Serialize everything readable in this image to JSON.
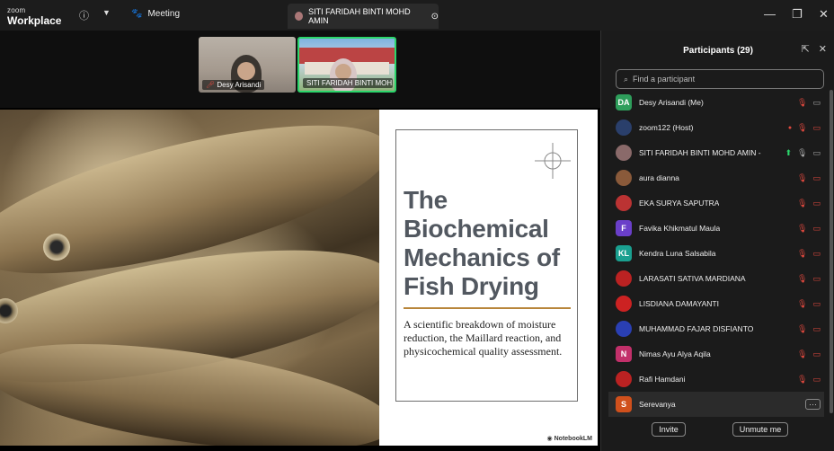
{
  "app": {
    "brand_small": "zoom",
    "brand_large": "Workplace"
  },
  "titlebar": {
    "meeting_label": "Meeting",
    "active_tab_label": "SITI FARIDAH BINTI MOHD AMIN"
  },
  "videos": [
    {
      "name": "Desy Arisandi"
    },
    {
      "name": "SITI FARIDAH BINTI MOH..."
    }
  ],
  "slide": {
    "title": "The Biochemical Mechanics of Fish Drying",
    "subtitle": "A scientific breakdown of moisture reduction, the Maillard reaction, and physicochemical quality assessment.",
    "watermark": "NotebookLM"
  },
  "panel": {
    "title": "Participants (29)",
    "search_placeholder": "Find a participant",
    "participants": [
      {
        "initials": "DA",
        "name": "Desy Arisandi (Me)",
        "color": "#2e9e5b",
        "photo": false
      },
      {
        "initials": "",
        "name": "zoom122 (Host)",
        "color": "#2a3f6b",
        "photo": true
      },
      {
        "initials": "",
        "name": "SITI FARIDAH BINTI MOHD AMIN -",
        "color": "#8a6a6a",
        "photo": true
      },
      {
        "initials": "",
        "name": "aura dianna",
        "color": "#8a5a3a",
        "photo": true
      },
      {
        "initials": "",
        "name": "EKA SURYA SAPUTRA",
        "color": "#b33",
        "photo": true
      },
      {
        "initials": "F",
        "name": "Favika Khikmatul Maula",
        "color": "#6a3fc9",
        "photo": false
      },
      {
        "initials": "KL",
        "name": "Kendra Luna Salsabila",
        "color": "#1aa090",
        "photo": false
      },
      {
        "initials": "",
        "name": "LARASATI SATIVA MARDIANA",
        "color": "#b22",
        "photo": true
      },
      {
        "initials": "",
        "name": "LISDIANA DAMAYANTI",
        "color": "#c22",
        "photo": true
      },
      {
        "initials": "",
        "name": "MUHAMMAD FAJAR DISFIANTO",
        "color": "#2a3fb3",
        "photo": true
      },
      {
        "initials": "N",
        "name": "Nimas Ayu Alya Aqila",
        "color": "#c2306a",
        "photo": false
      },
      {
        "initials": "",
        "name": "Rafi Hamdani",
        "color": "#b22",
        "photo": true
      },
      {
        "initials": "S",
        "name": "Serevanya",
        "color": "#d0501c",
        "photo": false
      }
    ],
    "invite_label": "Invite",
    "unmute_label": "Unmute me"
  }
}
